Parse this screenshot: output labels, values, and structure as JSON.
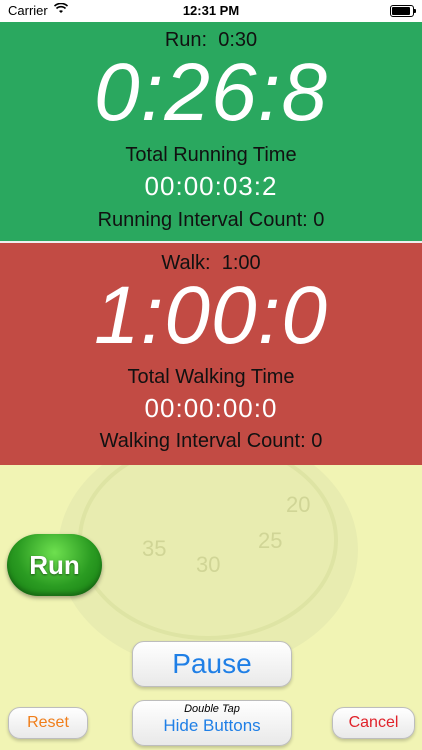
{
  "status_bar": {
    "carrier": "Carrier",
    "time": "12:31 PM"
  },
  "run_panel": {
    "interval_label": "Run:",
    "interval_value": "0:30",
    "timer": "0:26:8",
    "total_label": "Total Running Time",
    "total_value": "00:00:03:2",
    "count_label": "Running Interval Count:",
    "count_value": "0",
    "color": "#2aa85f"
  },
  "walk_panel": {
    "interval_label": "Walk:",
    "interval_value": "1:00",
    "timer": "1:00:0",
    "total_label": "Total Walking Time",
    "total_value": "00:00:00:0",
    "count_label": "Walking Interval Count:",
    "count_value": "0",
    "color": "#c24b44"
  },
  "background_watch": {
    "numbers": [
      "20",
      "25",
      "30",
      "35"
    ]
  },
  "buttons": {
    "run": "Run",
    "pause": "Pause",
    "reset": "Reset",
    "cancel": "Cancel",
    "hide_hint": "Double Tap",
    "hide": "Hide Buttons"
  }
}
